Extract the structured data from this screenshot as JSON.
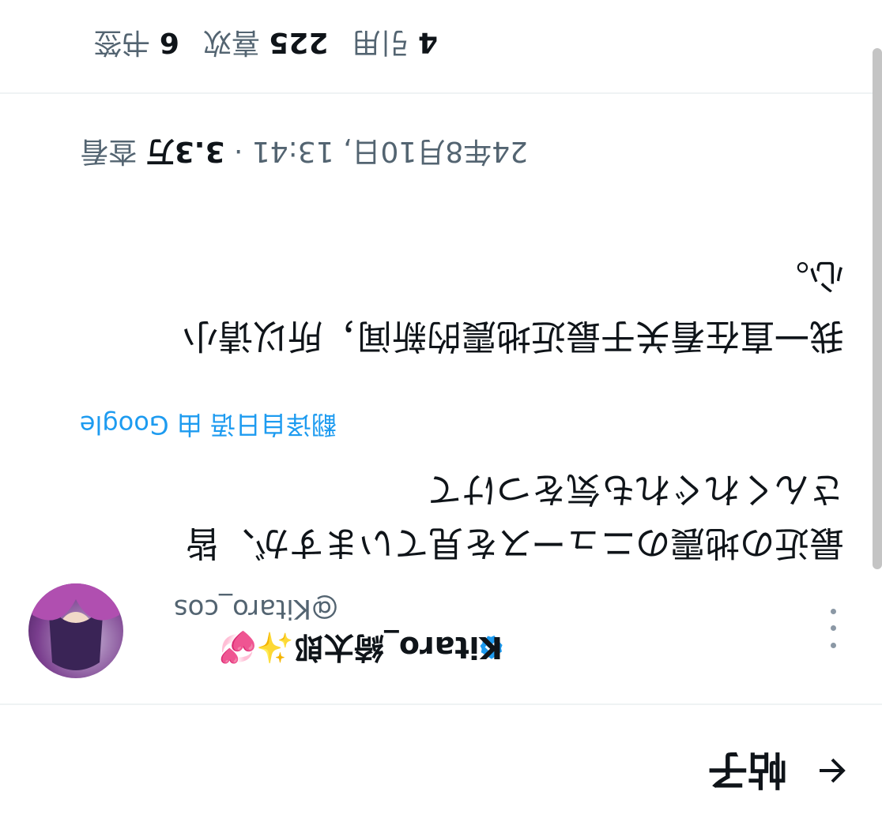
{
  "header": {
    "title": "帖子",
    "back_icon": "arrow-left-icon"
  },
  "author": {
    "display_name": "Kitaro_綺太郎",
    "emoji": "✨💞",
    "handle": "@Kitaro_cos",
    "verified_icon": "verified-badge-icon",
    "more_icon": "more-vertical-icon"
  },
  "tweet": {
    "text_line1": "最近の地震のニュースを見ていますが、皆",
    "text_line2": "さんくれぐれも気をつけて",
    "translate_label": "翻译自日语",
    "translate_via": "由 Google",
    "translated_line1": "我一直在看关于最近地震的新闻，所以请小",
    "translated_line2": "心。"
  },
  "meta": {
    "timestamp": "24年8月10日, 13:41",
    "dot": "·",
    "views_count": "3.3万",
    "views_label": "查看"
  },
  "stats": {
    "quotes_count": "4",
    "quotes_label": "引用",
    "likes_count": "225",
    "likes_label": "喜欢",
    "bookmarks_count": "6",
    "bookmarks_label": "书签"
  },
  "colors": {
    "accent": "#1d9bf0",
    "secondary_text": "#536471",
    "text": "#0f1419",
    "verified": "#1d9bf0"
  }
}
